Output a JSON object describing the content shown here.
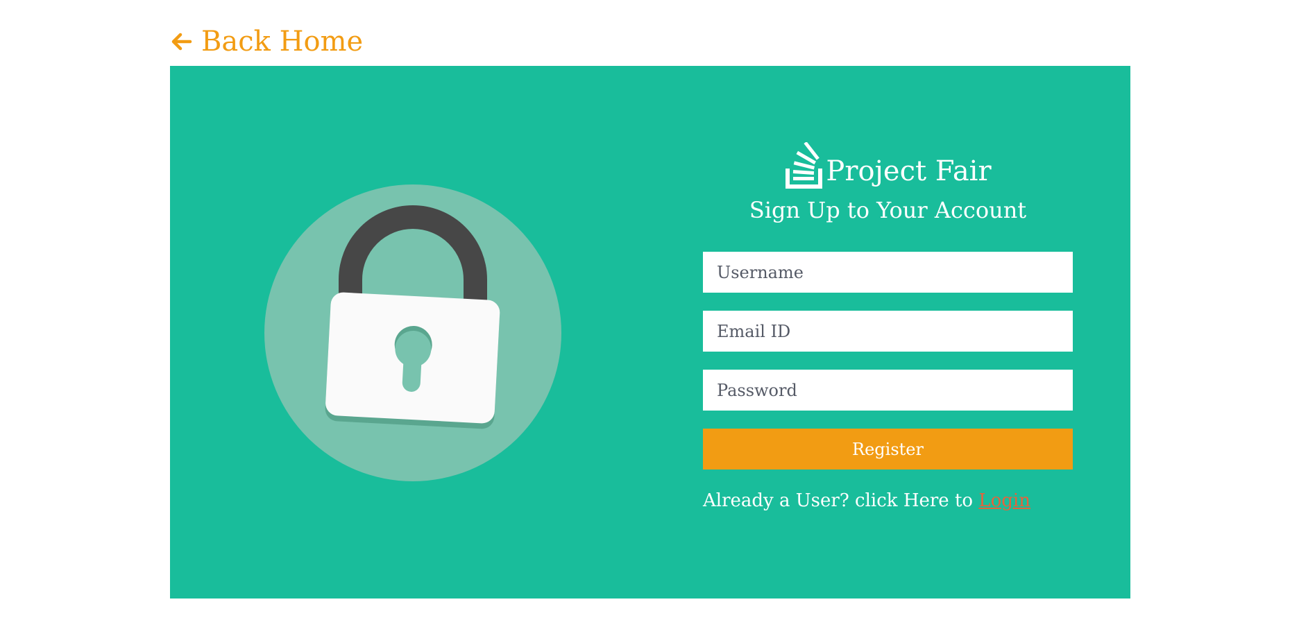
{
  "nav": {
    "back_home_label": "Back Home",
    "back_icon": "arrow-left-icon"
  },
  "brand": {
    "name": "Project Fair",
    "logo_icon": "stack-logo-icon"
  },
  "form": {
    "title": "Sign Up to Your Account",
    "username_placeholder": "Username",
    "email_placeholder": "Email ID",
    "password_placeholder": "Password",
    "register_label": "Register",
    "login_prompt": "Already a User? click Here to",
    "login_link_label": "Login"
  },
  "illustration": {
    "icon": "padlock-icon"
  },
  "colors": {
    "panel": "#19bd9b",
    "accent": "#f29c13",
    "login_link": "#e5633b",
    "circle": "#78c3ae",
    "shackle": "#474747"
  }
}
